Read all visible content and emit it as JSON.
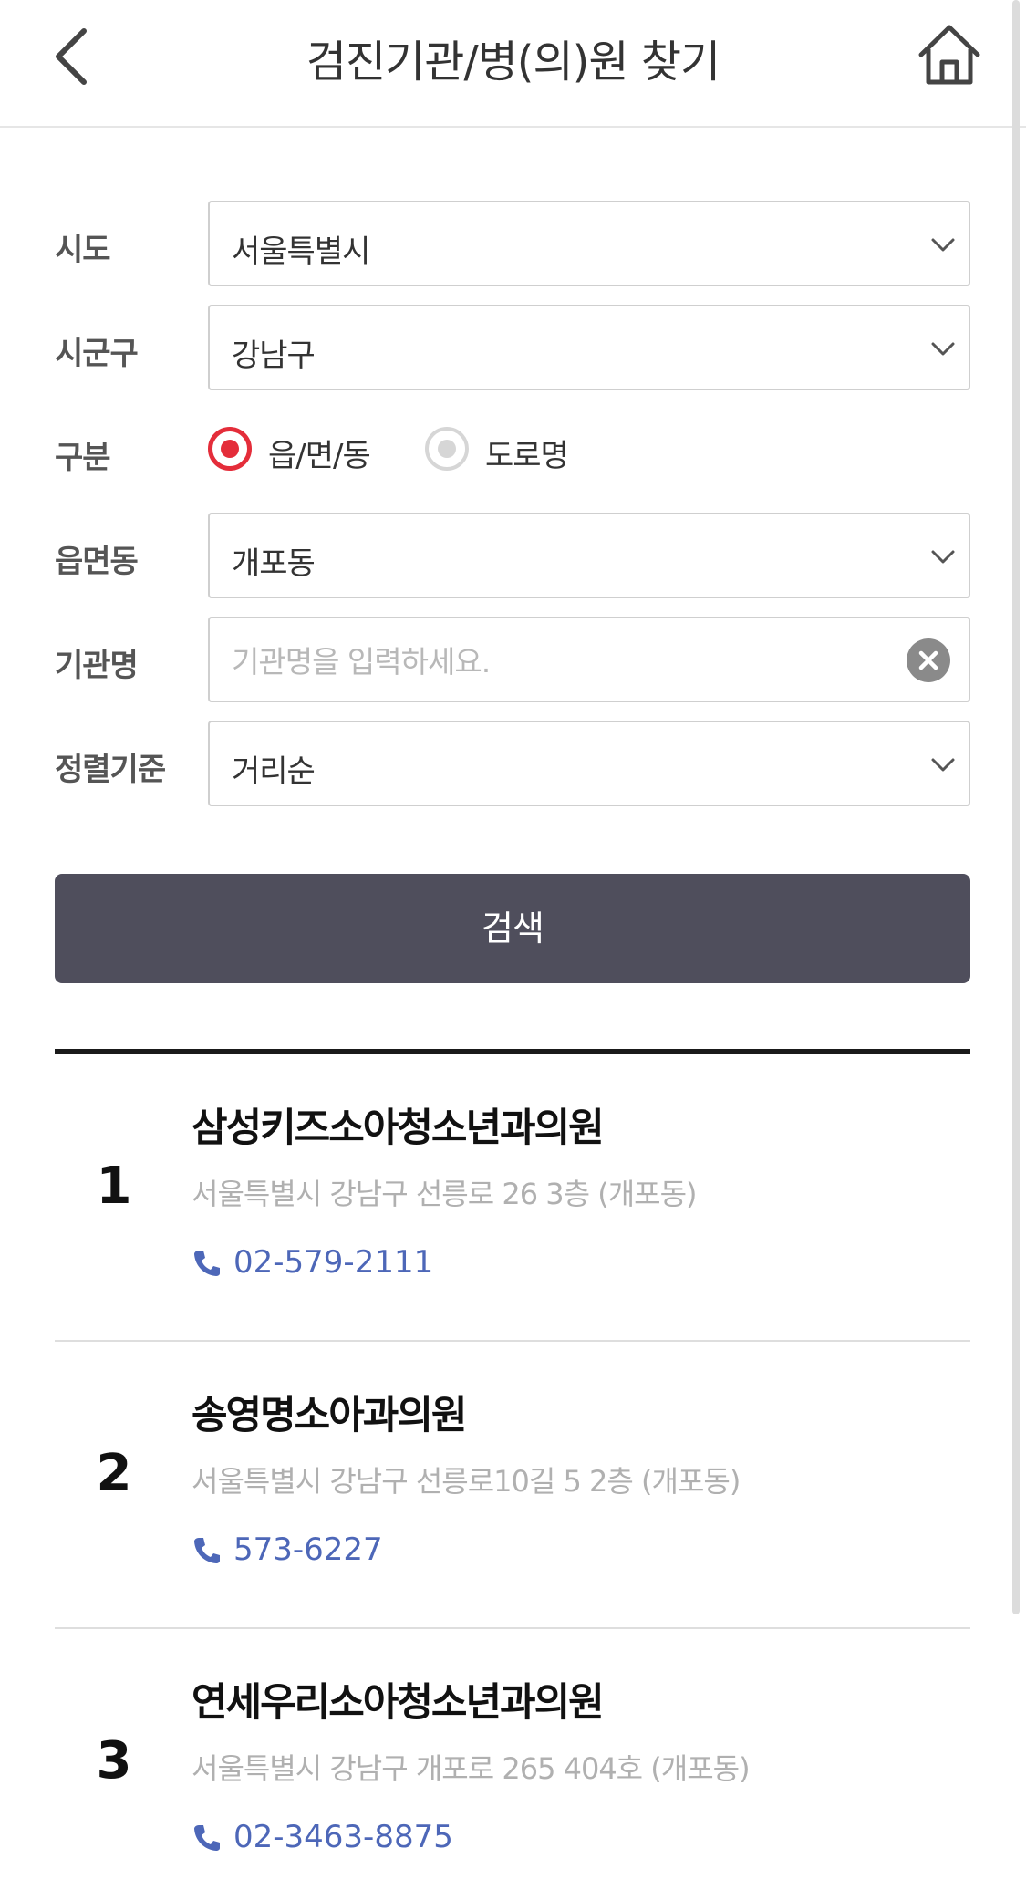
{
  "header": {
    "title": "검진기관/병(의)원 찾기",
    "back_icon": "chevron-left-icon",
    "home_icon": "home-icon"
  },
  "form": {
    "sido": {
      "label": "시도",
      "value": "서울특별시"
    },
    "sigungu": {
      "label": "시군구",
      "value": "강남구"
    },
    "type": {
      "label": "구분",
      "options": [
        {
          "label": "읍/면/동",
          "checked": true
        },
        {
          "label": "도로명",
          "checked": false
        }
      ]
    },
    "dong": {
      "label": "읍면동",
      "value": "개포동"
    },
    "name": {
      "label": "기관명",
      "placeholder": "기관명을 입력하세요.",
      "value": ""
    },
    "sort": {
      "label": "정렬기준",
      "value": "거리순"
    },
    "search_label": "검색"
  },
  "colors": {
    "accent_red": "#e42d3a",
    "button_dark": "#4f4e5c",
    "phone_blue": "#4d67b8"
  },
  "results": [
    {
      "number": "1",
      "name": "삼성키즈소아청소년과의원",
      "address": "서울특별시 강남구 선릉로 26 3층 (개포동)",
      "phone": "02-579-2111"
    },
    {
      "number": "2",
      "name": "송영명소아과의원",
      "address": "서울특별시 강남구 선릉로10길 5 2층 (개포동)",
      "phone": "573-6227"
    },
    {
      "number": "3",
      "name": "연세우리소아청소년과의원",
      "address": "서울특별시 강남구 개포로 265 404호 (개포동)",
      "phone": "02-3463-8875"
    }
  ]
}
